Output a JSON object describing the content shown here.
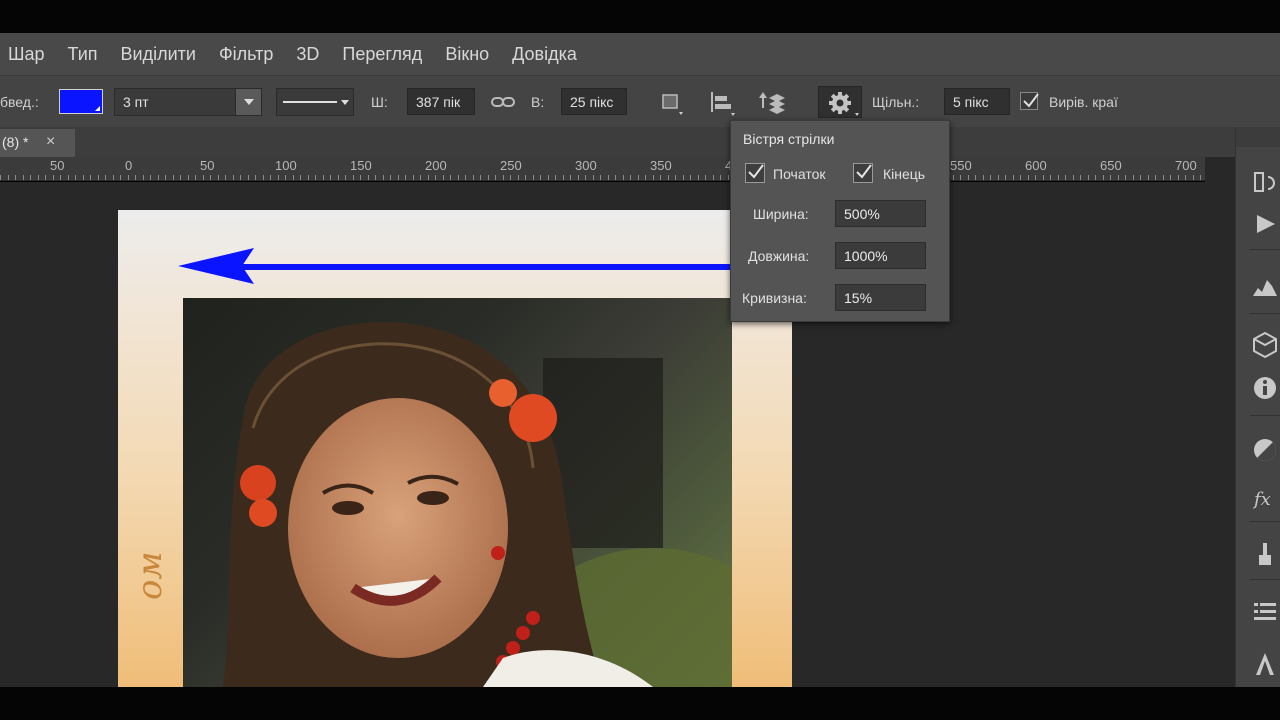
{
  "menu": {
    "items": [
      "Шар",
      "Тип",
      "Виділити",
      "Фільтр",
      "3D",
      "Перегляд",
      "Вікно",
      "Довідка"
    ]
  },
  "options": {
    "stroke_label": "бвед.:",
    "stroke_color": "#0a14ff",
    "stroke_width": "3 пт",
    "width_label": "Ш:",
    "width_value": "387 пік",
    "height_label": "В:",
    "height_value": "25 пікс",
    "weight_label": "Щільн.:",
    "weight_value": "5 пікс",
    "align_edges_label": "Вирів. краї",
    "align_edges_checked": true
  },
  "document": {
    "tab_title": "(8) *",
    "tab_close": "×",
    "frame_text": "ом"
  },
  "ruler": {
    "labels": [
      "50",
      "0",
      "50",
      "100",
      "150",
      "200",
      "250",
      "300",
      "350",
      "4",
      "550",
      "600",
      "650",
      "700"
    ]
  },
  "arrowheads_popup": {
    "title": "Вістря стрілки",
    "start_label": "Початок",
    "start_checked": true,
    "end_label": "Кінець",
    "end_checked": true,
    "width_label": "Ширина:",
    "width_value": "500%",
    "length_label": "Довжина:",
    "length_value": "1000%",
    "concavity_label": "Кривизна:",
    "concavity_value": "15%"
  },
  "icons": {
    "link": "link-icon",
    "settings": "gear-icon",
    "align": "align-icon",
    "arrange": "arrange-icon",
    "path_ops": "path-operations-icon"
  },
  "colors": {
    "arrow": "#0a14ff",
    "ui_bg": "#444444",
    "menu_bg": "#494949",
    "workspace": "#282828"
  }
}
